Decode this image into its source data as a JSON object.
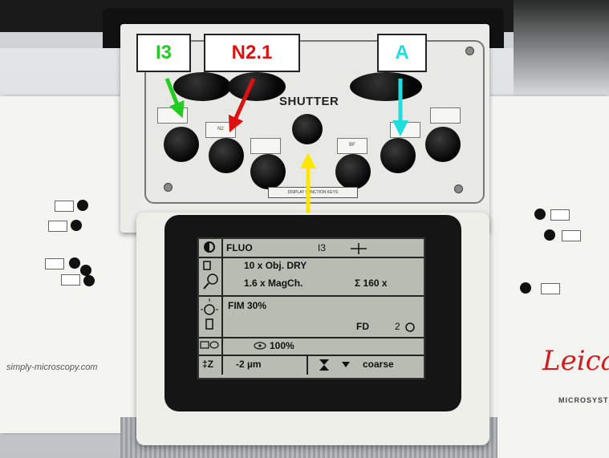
{
  "callouts": [
    {
      "label": "I3",
      "color": "#22cc22"
    },
    {
      "label": "N2.1",
      "color": "#dd1111"
    },
    {
      "label": "A",
      "color": "#22dddd"
    }
  ],
  "arrow_yellow": "#ffe600",
  "keypanel": {
    "shutter_label": "SHUTTER",
    "display_keys_label": "DISPLAY FUNCTION KEYS",
    "slot_labels": {
      "n2": "N2",
      "bf": "BF"
    }
  },
  "lcd": {
    "mode": "FLUO",
    "filter": "I3",
    "objective": "10 x Obj. DRY",
    "magchanger": "1.6 x MagCh.",
    "total_mag": "Σ 160 x",
    "illumination": "FIM  30%",
    "field_diaphragm": "FD",
    "fd_value": "2",
    "camera_split": "100%",
    "z_label": "‡Z",
    "z_step": "-2 µm",
    "focus_mode": "coarse"
  },
  "branding": {
    "url": "simply-microscopy.com",
    "logo": "Leica",
    "subtitle": "MICROSYSTEMS"
  }
}
